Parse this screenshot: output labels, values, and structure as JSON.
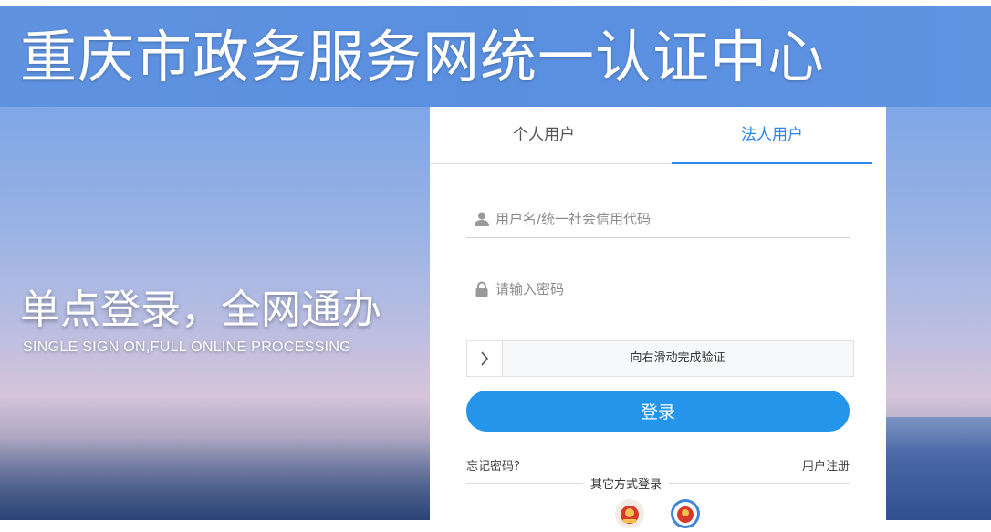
{
  "header": {
    "title": "重庆市政务服务网统一认证中心"
  },
  "hero": {
    "slogan_cn": "单点登录，全网通办",
    "slogan_en": "SINGLE SIGN ON,FULL ONLINE PROCESSING"
  },
  "login": {
    "tabs": [
      {
        "label": "个人用户",
        "active": false
      },
      {
        "label": "法人用户",
        "active": true
      }
    ],
    "username": {
      "placeholder": "用户名/统一社会信用代码",
      "icon": "user-icon"
    },
    "password": {
      "placeholder": "请输入密码",
      "icon": "lock-icon"
    },
    "slider": {
      "text": "向右滑动完成验证",
      "icon": "chevron-right-icon"
    },
    "submit_label": "登录",
    "forgot_label": "忘记密码?",
    "register_label": "用户注册",
    "alt_login_label": "其它方式登录",
    "alt_login_icons": [
      "national-emblem-icon",
      "national-emblem-blue-icon"
    ]
  },
  "colors": {
    "header_bg": "#5a8fe0",
    "accent": "#2f86e8",
    "button": "#2595ec"
  }
}
